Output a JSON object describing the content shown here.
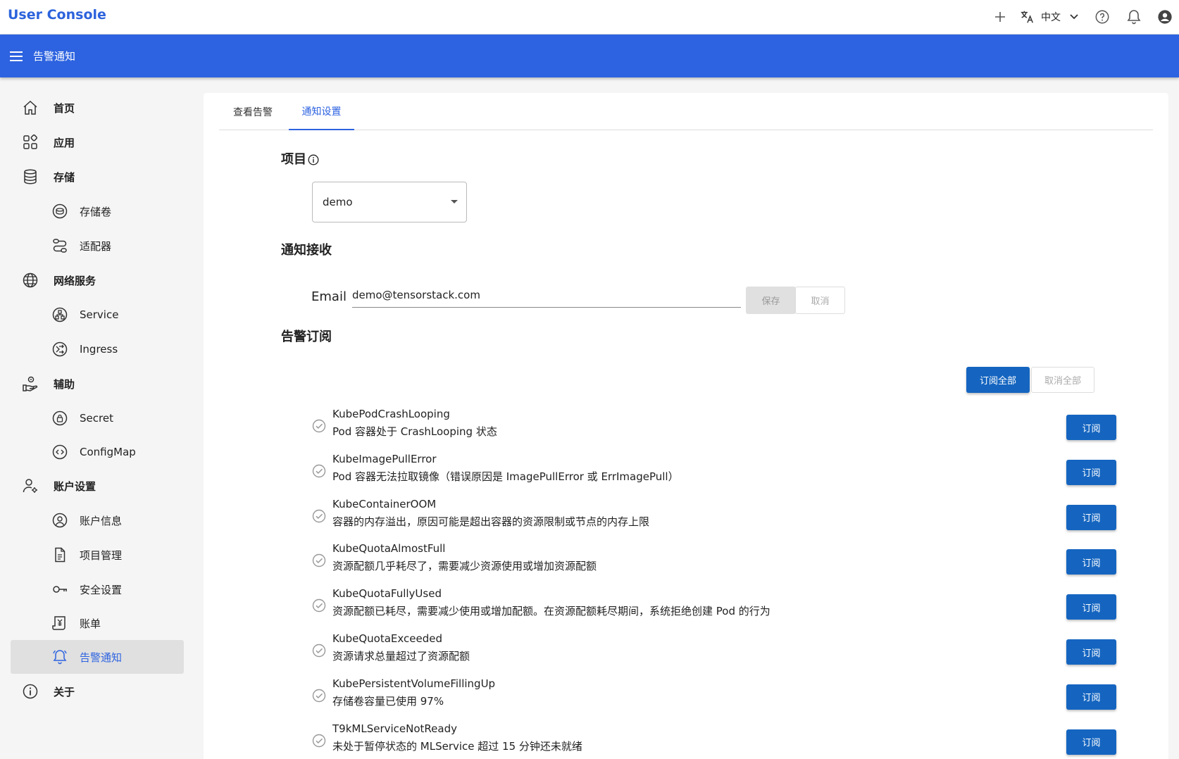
{
  "app": {
    "title": "User Console",
    "language": "中文"
  },
  "header": {
    "title": "告警通知"
  },
  "sidebar": {
    "items": [
      {
        "label": "首页",
        "icon": "home-icon"
      },
      {
        "label": "应用",
        "icon": "apps-icon"
      },
      {
        "label": "存储",
        "icon": "database-icon"
      },
      {
        "label": "存储卷",
        "icon": "volume-icon"
      },
      {
        "label": "适配器",
        "icon": "adapter-icon"
      },
      {
        "label": "网络服务",
        "icon": "globe-icon"
      },
      {
        "label": "Service",
        "icon": "service-icon"
      },
      {
        "label": "Ingress",
        "icon": "ingress-icon"
      },
      {
        "label": "辅助",
        "icon": "assist-icon"
      },
      {
        "label": "Secret",
        "icon": "lock-icon"
      },
      {
        "label": "ConfigMap",
        "icon": "code-icon"
      },
      {
        "label": "账户设置",
        "icon": "user-settings-icon"
      },
      {
        "label": "账户信息",
        "icon": "account-icon"
      },
      {
        "label": "项目管理",
        "icon": "document-icon"
      },
      {
        "label": "安全设置",
        "icon": "key-icon"
      },
      {
        "label": "账单",
        "icon": "bill-icon"
      },
      {
        "label": "告警通知",
        "icon": "bell-icon"
      },
      {
        "label": "关于",
        "icon": "info-icon"
      }
    ]
  },
  "tabs": [
    {
      "label": "查看告警"
    },
    {
      "label": "通知设置"
    }
  ],
  "project": {
    "title": "项目",
    "selected": "demo"
  },
  "notify": {
    "title": "通知接收",
    "email_label": "Email",
    "email_value": "demo@tensorstack.com",
    "save_label": "保存",
    "cancel_label": "取消"
  },
  "subscriptions": {
    "title": "告警订阅",
    "subscribe_all_label": "订阅全部",
    "unsubscribe_all_label": "取消全部",
    "subscribe_label": "订阅",
    "alerts": [
      {
        "name": "KubePodCrashLooping",
        "desc": "Pod 容器处于 CrashLooping 状态"
      },
      {
        "name": "KubeImagePullError",
        "desc": "Pod 容器无法拉取镜像（错误原因是 ImagePullError 或 ErrImagePull）"
      },
      {
        "name": "KubeContainerOOM",
        "desc": "容器的内存溢出，原因可能是超出容器的资源限制或节点的内存上限"
      },
      {
        "name": "KubeQuotaAlmostFull",
        "desc": "资源配额几乎耗尽了，需要减少资源使用或增加资源配额"
      },
      {
        "name": "KubeQuotaFullyUsed",
        "desc": "资源配额已耗尽，需要减少使用或增加配额。在资源配额耗尽期间，系统拒绝创建 Pod 的行为"
      },
      {
        "name": "KubeQuotaExceeded",
        "desc": "资源请求总量超过了资源配额"
      },
      {
        "name": "KubePersistentVolumeFillingUp",
        "desc": "存储卷容量已使用 97%"
      },
      {
        "name": "T9kMLServiceNotReady",
        "desc": "未处于暂停状态的 MLService 超过 15 分钟还未就绪"
      }
    ]
  },
  "colors": {
    "brand": "#2d63e0",
    "button": "#1565c0"
  }
}
